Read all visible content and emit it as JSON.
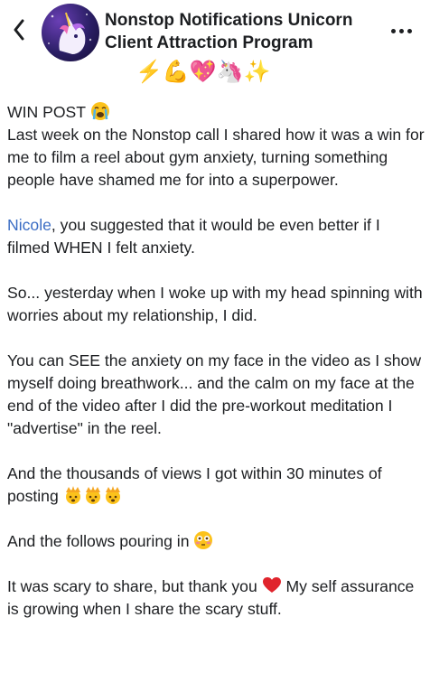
{
  "header": {
    "title_line1": "Nonstop Notifications Unicorn",
    "title_line2": "Client Attraction Program",
    "emoji_row": "⚡💪💖🦄✨"
  },
  "post": {
    "win_label": "WIN POST",
    "p1": "Last week on the Nonstop call I shared how it was a win for me to film a reel about gym anxiety, turning something people have shamed me for into a superpower.",
    "mention": "Nicole",
    "p2_rest": ", you suggested that it would be even better if I filmed WHEN I felt anxiety.",
    "p3": "So... yesterday when I woke up with my head spinning with worries about my relationship, I did.",
    "p4": "You can SEE the anxiety on my face in the video as I show myself doing breathwork... and the calm on my face at the end of the video after I did the pre-workout meditation I \"advertise\" in the reel.",
    "p5": "And the thousands of views I got within 30 minutes of posting",
    "p6": "And the follows pouring in",
    "p7a": "It was scary to share, but thank you",
    "p7b": "My self assurance is growing when I share the scary stuff."
  },
  "icons": {
    "back": "chevron-left-icon",
    "more": "more-dots-icon",
    "crying": "loudly-crying-face-emoji",
    "mindblown": "exploding-head-emoji",
    "flushed": "flushed-face-emoji",
    "heart": "red-heart-emoji"
  },
  "colors": {
    "mention": "#3b6dc4",
    "text": "#1c1e21"
  }
}
